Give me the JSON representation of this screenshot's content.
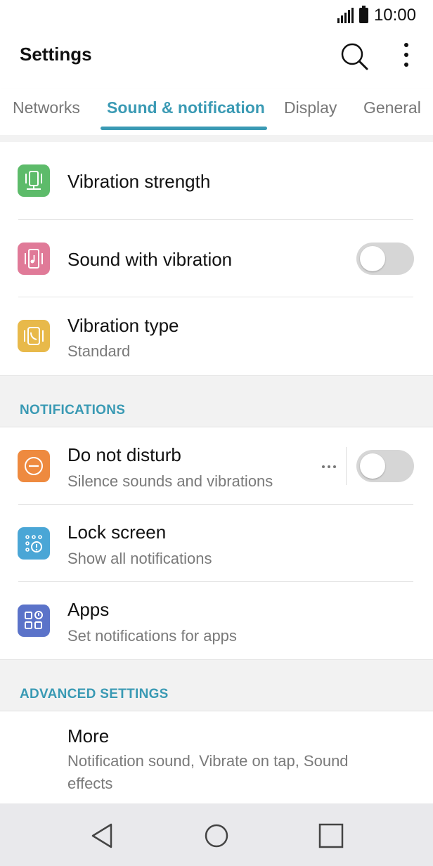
{
  "status_bar": {
    "time": "10:00",
    "signal_icon": "signal-icon",
    "battery_icon": "battery-icon"
  },
  "app_bar": {
    "title": "Settings",
    "search_icon": "search-icon",
    "more_icon": "more-vert-icon"
  },
  "tabs": [
    {
      "label": "Networks",
      "active": false
    },
    {
      "label": "Sound & notification",
      "active": true
    },
    {
      "label": "Display",
      "active": false
    },
    {
      "label": "General",
      "active": false
    }
  ],
  "vibration_rows": [
    {
      "title": "Vibration strength",
      "icon": "vibration-strength-icon",
      "icon_color": "#5dbb6a"
    },
    {
      "title": "Sound with vibration",
      "icon": "sound-vibration-icon",
      "icon_color": "#e07a98",
      "toggle_on": false
    },
    {
      "title": "Vibration type",
      "subtitle": "Standard",
      "icon": "vibration-type-icon",
      "icon_color": "#e8b94a"
    }
  ],
  "notifications_section": {
    "header": "NOTIFICATIONS",
    "rows": [
      {
        "title": "Do not disturb",
        "subtitle": "Silence sounds and vibrations",
        "icon": "do-not-disturb-icon",
        "icon_color": "#ee8a3f",
        "toggle_on": false,
        "overflow_icon": "more-horiz-icon"
      },
      {
        "title": "Lock screen",
        "subtitle": "Show all notifications",
        "icon": "lock-screen-icon",
        "icon_color": "#4aa6d6"
      },
      {
        "title": "Apps",
        "subtitle": "Set notifications for apps",
        "icon": "apps-notification-icon",
        "icon_color": "#5b73c9"
      }
    ]
  },
  "advanced_section": {
    "header": "ADVANCED SETTINGS",
    "rows": [
      {
        "title": "More",
        "subtitle_line1": "Notification sound, Vibrate on tap, Sound",
        "subtitle_line2": "effects"
      }
    ]
  },
  "nav_bar": {
    "back_icon": "back-icon",
    "home_icon": "home-icon",
    "recents_icon": "recents-icon"
  },
  "colors": {
    "accent": "#3a9ab4",
    "section_bg": "#f2f2f2",
    "nav_bg": "#e9e9ec"
  }
}
